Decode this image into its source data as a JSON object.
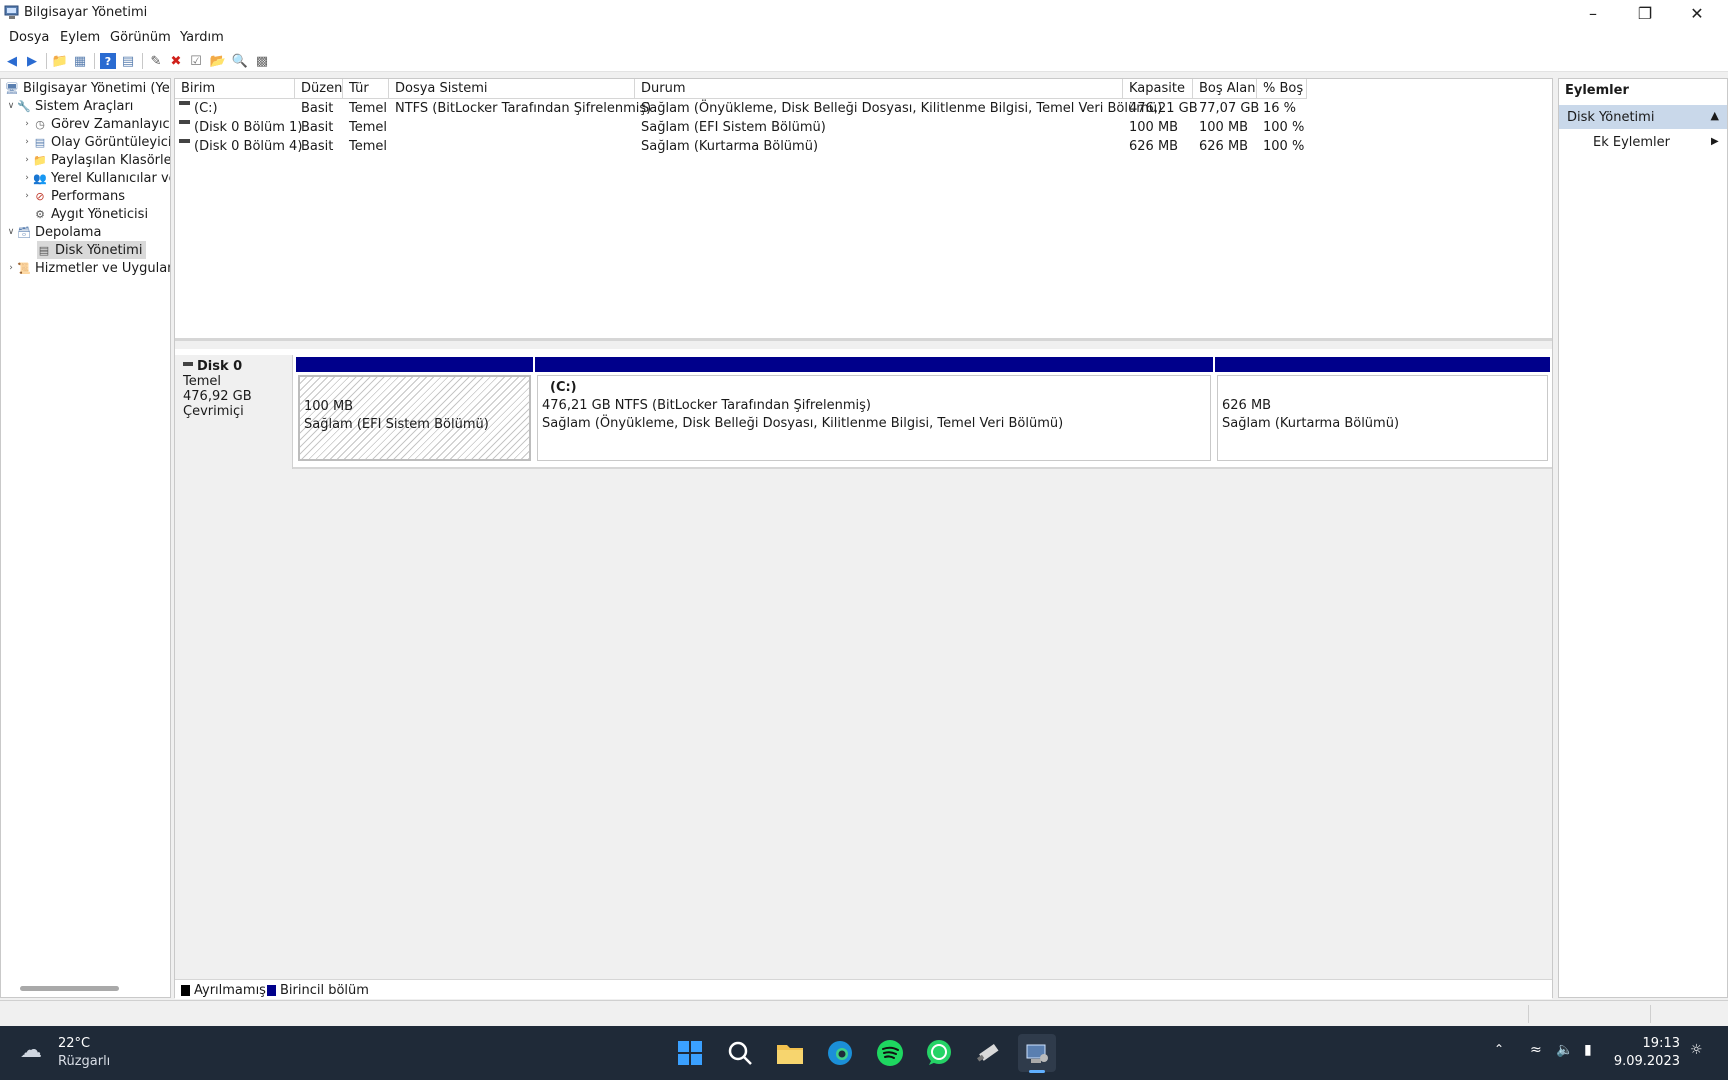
{
  "window": {
    "title": "Bilgisayar Yönetimi"
  },
  "menu": [
    "Dosya",
    "Eylem",
    "Görünüm",
    "Yardım"
  ],
  "tree": {
    "root": "Bilgisayar Yönetimi (Yere",
    "system_tools": "Sistem Araçları",
    "task_scheduler": "Görev Zamanlayıcı",
    "event_viewer": "Olay Görüntüleyici",
    "shared_folders": "Paylaşılan Klasörler",
    "local_users": "Yerel Kullanıcılar ve",
    "performance": "Performans",
    "device_manager": "Aygıt Yöneticisi",
    "storage": "Depolama",
    "disk_management": "Disk Yönetimi",
    "services": "Hizmetler ve Uygulam"
  },
  "columns": [
    "Birim",
    "Düzen",
    "Tür",
    "Dosya Sistemi",
    "Durum",
    "Kapasite",
    "Boş Alan",
    "% Boş"
  ],
  "volumes": [
    {
      "name": "(C:)",
      "layout": "Basit",
      "type": "Temel",
      "fs": "NTFS (BitLocker Tarafından Şifrelenmiş)",
      "status": "Sağlam (Önyükleme, Disk Belleği Dosyası, Kilitlenme Bilgisi, Temel Veri Bölümü)",
      "capacity": "476,21 GB",
      "free": "77,07 GB",
      "pct": "16 %"
    },
    {
      "name": "(Disk 0 Bölüm 1)",
      "layout": "Basit",
      "type": "Temel",
      "fs": "",
      "status": "Sağlam (EFI Sistem Bölümü)",
      "capacity": "100 MB",
      "free": "100 MB",
      "pct": "100 %"
    },
    {
      "name": "(Disk 0 Bölüm 4)",
      "layout": "Basit",
      "type": "Temel",
      "fs": "",
      "status": "Sağlam (Kurtarma Bölümü)",
      "capacity": "626 MB",
      "free": "626 MB",
      "pct": "100 %"
    }
  ],
  "disk": {
    "name": "Disk 0",
    "type": "Temel",
    "size": "476,92 GB",
    "state": "Çevrimiçi",
    "partitions": [
      {
        "title": "",
        "size": "100 MB",
        "status": "Sağlam (EFI Sistem Bölümü)"
      },
      {
        "title": "(C:)",
        "size": "476,21 GB NTFS (BitLocker Tarafından Şifrelenmiş)",
        "status": "Sağlam (Önyükleme, Disk Belleği Dosyası, Kilitlenme Bilgisi, Temel Veri Bölümü)"
      },
      {
        "title": "",
        "size": "626 MB",
        "status": "Sağlam (Kurtarma Bölümü)"
      }
    ]
  },
  "legend": {
    "unallocated": "Ayrılmamış",
    "primary": "Birincil bölüm",
    "unallocated_color": "#000000",
    "primary_color": "#00008b"
  },
  "actions": {
    "title": "Eylemler",
    "section": "Disk Yönetimi",
    "item": "Ek Eylemler"
  },
  "taskbar": {
    "temp": "22°C",
    "weather": "Rüzgarlı",
    "time": "19:13",
    "date": "9.09.2023"
  }
}
